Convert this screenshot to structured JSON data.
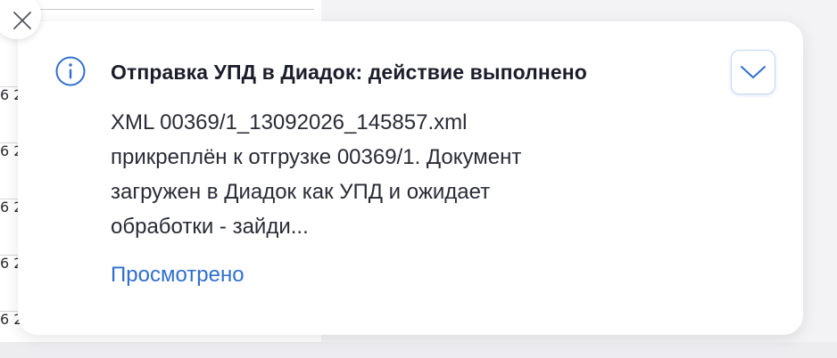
{
  "background": {
    "cell_prefix": "6 2",
    "rows": 6
  },
  "notification": {
    "title": "Отправка УПД в Диадок: действие выполнено",
    "message": "XML 00369/1_13092026_145857.xml\nприкреплён к отгрузке 00369/1. Документ\nзагружен в Диадок как УПД и ожидает\nобработки - зайди...",
    "viewed_label": "Просмотрено",
    "icons": {
      "info": "info-circle-icon",
      "expand": "chevron-down-icon",
      "close": "close-icon"
    },
    "colors": {
      "accent": "#2f6fd0",
      "title": "#1c1d2b",
      "text": "#2a2b36"
    }
  }
}
